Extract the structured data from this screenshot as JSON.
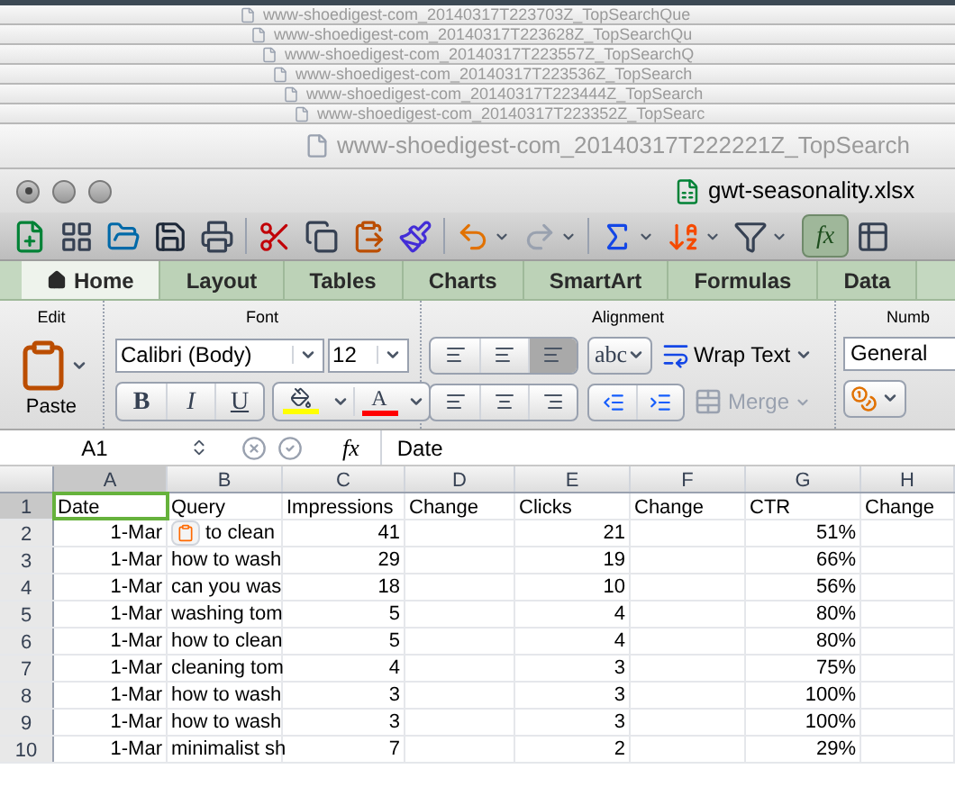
{
  "background_windows": [
    {
      "title": "www-shoedigest-com_20140317T223703Z_TopSearchQue"
    },
    {
      "title": "www-shoedigest-com_20140317T223628Z_TopSearchQu"
    },
    {
      "title": "www-shoedigest-com_20140317T223557Z_TopSearchQ"
    },
    {
      "title": "www-shoedigest-com_20140317T223536Z_TopSearch"
    },
    {
      "title": "www-shoedigest-com_20140317T223444Z_TopSearch"
    },
    {
      "title": "www-shoedigest-com_20140317T223352Z_TopSearc"
    },
    {
      "title": "www-shoedigest-com_20140317T222221Z_TopSearch"
    }
  ],
  "window": {
    "title": "gwt-seasonality.xlsx"
  },
  "toolbar": {
    "formula_builder": {
      "label": "fx",
      "selected": true
    }
  },
  "tabs": [
    {
      "label": "Home",
      "selected": true
    },
    {
      "label": "Layout",
      "selected": false
    },
    {
      "label": "Tables",
      "selected": false
    },
    {
      "label": "Charts",
      "selected": false
    },
    {
      "label": "SmartArt",
      "selected": false
    },
    {
      "label": "Formulas",
      "selected": false
    },
    {
      "label": "Data",
      "selected": false
    }
  ],
  "ribbon": {
    "edit": {
      "title": "Edit",
      "paste": "Paste"
    },
    "font": {
      "title": "Font",
      "font_name": "Calibri (Body)",
      "font_size": "12",
      "styles": [
        {
          "label": "B",
          "kind": "bold"
        },
        {
          "label": "I",
          "kind": "italic"
        },
        {
          "label": "U",
          "kind": "underline"
        }
      ],
      "fill_color": {
        "color": "#ffff00"
      },
      "font_color": {
        "label": "A",
        "color": "#ff0000"
      }
    },
    "alignment": {
      "title": "Alignment",
      "vertical": [
        {
          "selected": false
        },
        {
          "selected": false
        },
        {
          "selected": true
        }
      ],
      "orientation": "abc",
      "wrap_text": "Wrap Text",
      "merge": {
        "label": "Merge",
        "disabled": true
      }
    },
    "number": {
      "title": "Numb",
      "format": "General"
    }
  },
  "formula_bar": {
    "name_box": "A1",
    "fx": "fx",
    "value": "Date"
  },
  "sheet": {
    "columns": [
      "A",
      "B",
      "C",
      "D",
      "E",
      "F",
      "G",
      "H"
    ],
    "header_row": {
      "number": "1",
      "cells": [
        {
          "text": "Date",
          "selected": true
        },
        {
          "text": "Query",
          "selected": false
        },
        {
          "text": "Impressions",
          "selected": false
        },
        {
          "text": "Change",
          "selected": false
        },
        {
          "text": "Clicks",
          "selected": false
        },
        {
          "text": "Change",
          "selected": false
        },
        {
          "text": "CTR",
          "selected": false
        },
        {
          "text": "Change",
          "selected": false
        }
      ]
    },
    "rows": [
      {
        "number": "2",
        "date": "1-Mar",
        "query": "to clean",
        "impressions": "41",
        "clicks": "21",
        "ctr": "51%",
        "paste_options": true
      },
      {
        "number": "3",
        "date": "1-Mar",
        "query": "how to wash",
        "impressions": "29",
        "clicks": "19",
        "ctr": "66%",
        "paste_options": false
      },
      {
        "number": "4",
        "date": "1-Mar",
        "query": "can you was",
        "impressions": "18",
        "clicks": "10",
        "ctr": "56%",
        "paste_options": false
      },
      {
        "number": "5",
        "date": "1-Mar",
        "query": "washing tom",
        "impressions": "5",
        "clicks": "4",
        "ctr": "80%",
        "paste_options": false
      },
      {
        "number": "6",
        "date": "1-Mar",
        "query": "how to clean",
        "impressions": "5",
        "clicks": "4",
        "ctr": "80%",
        "paste_options": false
      },
      {
        "number": "7",
        "date": "1-Mar",
        "query": "cleaning tom",
        "impressions": "4",
        "clicks": "3",
        "ctr": "75%",
        "paste_options": false
      },
      {
        "number": "8",
        "date": "1-Mar",
        "query": "how to wash",
        "impressions": "3",
        "clicks": "3",
        "ctr": "100%",
        "paste_options": false
      },
      {
        "number": "9",
        "date": "1-Mar",
        "query": "how to wash",
        "impressions": "3",
        "clicks": "3",
        "ctr": "100%",
        "paste_options": false
      },
      {
        "number": "10",
        "date": "1-Mar",
        "query": "minimalist sh",
        "impressions": "7",
        "clicks": "2",
        "ctr": "29%",
        "paste_options": false
      }
    ]
  }
}
